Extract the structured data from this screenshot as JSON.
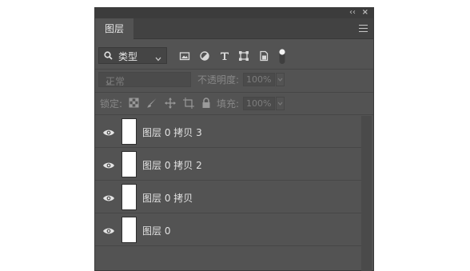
{
  "panel": {
    "title_controls": {
      "collapse": "‹‹",
      "close": "×"
    },
    "tab_label": "图层",
    "menu_icon": "hamburger-menu-icon"
  },
  "filter": {
    "selected": "类型",
    "icons": [
      "image-filter-icon",
      "adjustment-filter-icon",
      "type-filter-icon",
      "shape-filter-icon",
      "smart-object-filter-icon",
      "filter-toggle-icon"
    ]
  },
  "blend": {
    "mode": "正常",
    "opacity_label": "不透明度:",
    "opacity_value": "100%"
  },
  "lock": {
    "label": "锁定:",
    "icons": [
      "lock-transparent-pixels-icon",
      "lock-image-pixels-icon",
      "lock-position-icon",
      "artboard-nesting-icon",
      "lock-all-icon"
    ],
    "fill_label": "填充:",
    "fill_value": "100%"
  },
  "layers": [
    {
      "name": "图层 0 拷贝 3"
    },
    {
      "name": "图层 0 拷贝 2"
    },
    {
      "name": "图层 0 拷贝"
    },
    {
      "name": "图层 0"
    }
  ],
  "colors": {
    "panel_bg": "#535353",
    "tab_bar": "#424242",
    "thumbnail": "#ffffff"
  }
}
